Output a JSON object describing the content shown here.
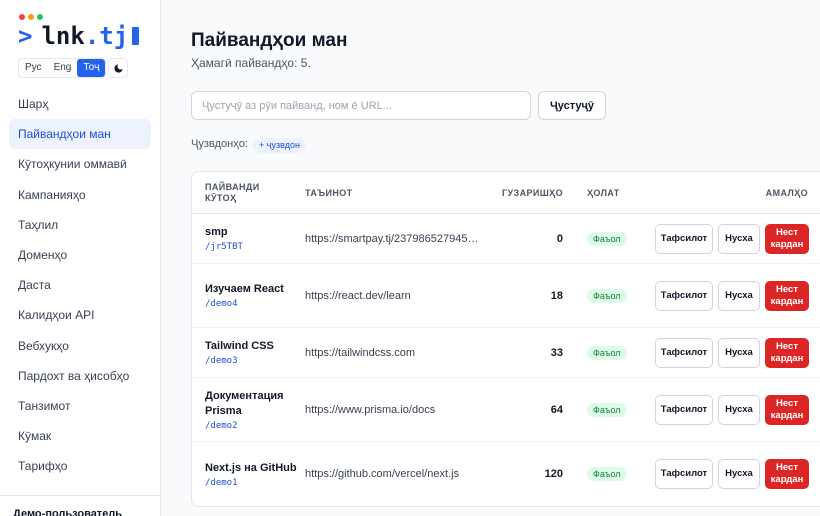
{
  "logo": {
    "prompt": ">",
    "name": "lnk",
    "dot": ".",
    "tld": "tj"
  },
  "window_dots": [
    "#ef4444",
    "#f59e0b",
    "#22c55e"
  ],
  "languages": [
    {
      "label": "Рус",
      "active": false
    },
    {
      "label": "Eng",
      "active": false
    },
    {
      "label": "Тоҷ",
      "active": true
    }
  ],
  "theme_toggle_icon": "moon-icon",
  "nav": [
    {
      "id": "shortener",
      "label": "Шарҳ",
      "active": false
    },
    {
      "id": "my-links",
      "label": "Пайвандҳои ман",
      "active": true
    },
    {
      "id": "public-short",
      "label": "Кӯтоҳкунии оммавӣ",
      "active": false
    },
    {
      "id": "campaigns",
      "label": "Кампанияҳо",
      "active": false
    },
    {
      "id": "analytics",
      "label": "Таҳлил",
      "active": false
    },
    {
      "id": "domains",
      "label": "Доменҳо",
      "active": false
    },
    {
      "id": "bundle",
      "label": "Даста",
      "active": false
    },
    {
      "id": "api-keys",
      "label": "Калидҳои API",
      "active": false
    },
    {
      "id": "webhooks",
      "label": "Вебхукҳо",
      "active": false
    },
    {
      "id": "billing",
      "label": "Пардохт ва ҳисобҳо",
      "active": false
    },
    {
      "id": "settings",
      "label": "Танзимот",
      "active": false
    },
    {
      "id": "help",
      "label": "Кӯмак",
      "active": false
    },
    {
      "id": "pricing",
      "label": "Тарифҳо",
      "active": false
    }
  ],
  "user": {
    "name": "Демо-пользователь"
  },
  "page": {
    "title": "Пайвандҳои ман",
    "subtitle": "Ҳамагӣ пайвандҳо: 5."
  },
  "search": {
    "placeholder": "Ҷустуҷӯ аз рӯи пайванд, ном ё URL...",
    "value": "",
    "button": "Ҷустуҷӯ"
  },
  "tags": {
    "label": "Ҷузвдонҳо:",
    "add": "+ ҷузвдон"
  },
  "table": {
    "headers": {
      "link": "ПАЙВАНДИ КӮТОҲ",
      "destination": "ТАЪИНОТ",
      "clicks": "ГУЗАРИШҲО",
      "status": "ҲОЛАТ",
      "actions": "АМАЛҲО"
    },
    "rows": [
      {
        "name": "smp",
        "slug": "/jr5TBT",
        "url": "https://smartpay.tj/237986527945…",
        "clicks": "0",
        "status": "Фаъол"
      },
      {
        "name": "Изучаем React",
        "slug": "/demo4",
        "url": "https://react.dev/learn",
        "clicks": "18",
        "status": "Фаъол"
      },
      {
        "name": "Tailwind CSS",
        "slug": "/demo3",
        "url": "https://tailwindcss.com",
        "clicks": "33",
        "status": "Фаъол"
      },
      {
        "name": "Документация Prisma",
        "slug": "/demo2",
        "url": "https://www.prisma.io/docs",
        "clicks": "64",
        "status": "Фаъол"
      },
      {
        "name": "Next.js на GitHub",
        "slug": "/demo1",
        "url": "https://github.com/vercel/next.js",
        "clicks": "120",
        "status": "Фаъол"
      }
    ],
    "actions": {
      "details": "Тафсилот",
      "copy": "Нусха",
      "delete": "Нест кардан"
    }
  },
  "colors": {
    "accent": "#2563eb",
    "danger": "#dc2626",
    "success": "#15803d"
  }
}
